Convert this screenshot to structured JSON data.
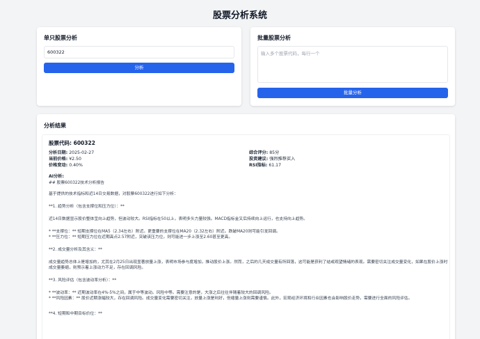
{
  "header": {
    "title": "股票分析系统"
  },
  "single": {
    "title": "单只股票分析",
    "input_value": "600322",
    "button_label": "分析"
  },
  "batch": {
    "title": "批量股票分析",
    "placeholder": "输入多个股票代码，每行一个",
    "button_label": "批量分析"
  },
  "result": {
    "title": "分析结果",
    "stock_code_label": "股票代码: 600322",
    "left": [
      {
        "label": "分析日期:",
        "value": "2025-02-27"
      },
      {
        "label": "当前价格:",
        "value": "¥2.50"
      },
      {
        "label": "价格变动:",
        "value": "0.40%"
      }
    ],
    "right": [
      {
        "label": "综合评分:",
        "value": "85分"
      },
      {
        "label": "投资建议:",
        "value": "强烈推荐买入"
      },
      {
        "label": "RSI指标:",
        "value": "61.17"
      }
    ],
    "ai_label": "AI分析:",
    "report": [
      "## 股票600322技术分析报告",
      "基于提供的技术指标和近14日交易数据，对股票600322进行如下分析：",
      "**1. 趋势分析（包含支撑位和压力位）：**",
      "近14日数据显示股价整体呈向上趋势，但波动较大。RSI指标在50以上，表明多头力量较强。MACD指标金叉后持续向上运行，也支持向上趋势。",
      "* **支撑位：** 短期支撑位在MA5（2.34左右）附近。更重要的支撑位在MA20（2.32左右）附近。跌破MA20则可能引发回调。\n* **压力位：** 短期压力位在近期高点2.57附近，突破该压力位，则可能进一步上涨至2.60甚至更高。",
      "**2. 成交量分析及其含义：**",
      "成交量趋势总体上是增加的，尤其在2月25日出现显著放量上涨，表明市场参与度增加，推动股价上涨。然而，之后的几天成交量有所回落，这可能是获利了结或观望情绪的表现。需要密切关注成交量变化，如果在股价上涨时成交量萎缩，则预示着上涨动力不足，存在回调风险。",
      "**3. 风险评估（包含波动率分析）：**",
      "* **波动率：** 近期波动率在4%-5%之间，属于中等波动。风险中等。需要注意的是，大涨之后往往伴随着较大的回调风险。\n* **风险因素：** 股价近期涨幅较大，存在回调风险。成交量变化需要密切关注，放量上涨是利好，但缩量上涨则需要谨慎。此外，宏观经济环境和行业因素也会影响股价走势，需要进行全面的风险评估。",
      "**4. 短期和中期目标价位：**"
    ]
  }
}
